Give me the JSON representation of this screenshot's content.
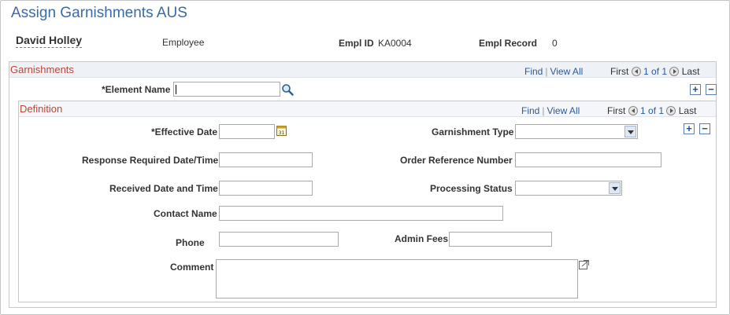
{
  "page": {
    "title": "Assign Garnishments AUS"
  },
  "employee": {
    "name": "David Holley",
    "type_label": "Employee",
    "empl_id_label": "Empl ID",
    "empl_id": "KA0004",
    "empl_record_label": "Empl Record",
    "empl_record": "0"
  },
  "garnishments": {
    "title": "Garnishments",
    "nav": {
      "find": "Find",
      "sep": "|",
      "view_all": "View All",
      "first": "First",
      "count": "1 of 1",
      "last": "Last"
    },
    "element_name_label": "*Element Name",
    "element_name_value": "",
    "add": "+",
    "remove": "−"
  },
  "definition": {
    "title": "Definition",
    "nav": {
      "find": "Find",
      "sep": "|",
      "view_all": "View All",
      "first": "First",
      "count": "1 of 1",
      "last": "Last"
    },
    "add": "+",
    "remove": "−",
    "fields": {
      "effective_date": {
        "label": "*Effective Date",
        "value": ""
      },
      "garnishment_type": {
        "label": "Garnishment Type",
        "value": ""
      },
      "response_required": {
        "label": "Response Required Date/Time",
        "value": ""
      },
      "order_reference": {
        "label": "Order Reference Number",
        "value": ""
      },
      "received_date": {
        "label": "Received Date and Time",
        "value": ""
      },
      "processing_status": {
        "label": "Processing Status",
        "value": ""
      },
      "contact_name": {
        "label": "Contact Name",
        "value": ""
      },
      "phone": {
        "label": "Phone",
        "value": ""
      },
      "admin_fees": {
        "label": "Admin Fees",
        "value": ""
      },
      "comment": {
        "label": "Comment",
        "value": ""
      }
    },
    "calendar_icon_text": "31"
  }
}
